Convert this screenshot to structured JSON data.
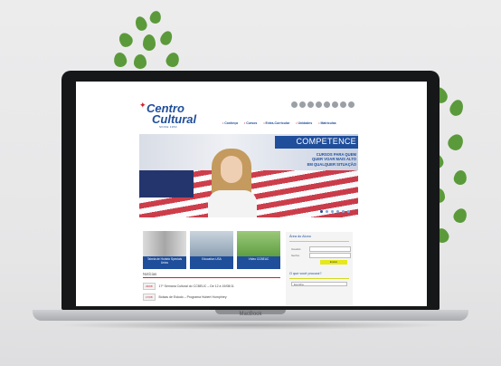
{
  "site": {
    "logo": {
      "line1": "Centro",
      "line2": "Cultural",
      "since": "SINCE 1963"
    },
    "nav": [
      "Conheça",
      "Cursos",
      "Extra-Curricular",
      "Unidades",
      "Matrículas"
    ],
    "hero": {
      "title": "COMPETENCE",
      "subtitle": [
        "CURSOS PARA QUEM",
        "QUER VOAR MAIS ALTO",
        "EM QUALQUER SITUAÇÃO"
      ]
    },
    "tiles": [
      {
        "caption": "Tabela de Horário Specials Unics",
        "image": "hourglass"
      },
      {
        "caption": "Education USA",
        "image": "student"
      },
      {
        "caption": "Vídeo CCBEUC",
        "image": "outdoor"
      }
    ],
    "news_heading": "Notícias",
    "news": [
      {
        "date": "29/08",
        "text": "17º Semana Cultural do CCBEUC – De 12 à 19/08/11"
      },
      {
        "date": "17/08",
        "text": "Bolsas de Estudo – Programa Hubert Humphrey"
      }
    ],
    "aside": {
      "login_title": "Área do Aluno",
      "user_label": "Usuário:",
      "pass_label": "Senha:",
      "enter_label": "Entrar",
      "question_title": "O que você procura?",
      "select_value": "Escolha"
    }
  },
  "device": {
    "brand": "MacBook"
  }
}
